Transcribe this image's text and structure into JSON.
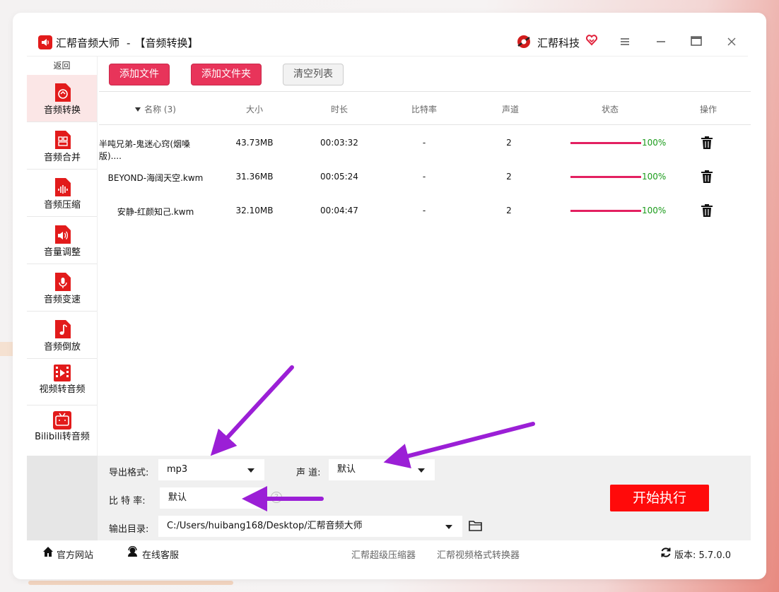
{
  "app": {
    "title": "汇帮音频大师",
    "separator": "-",
    "current_module": "【音频转换】",
    "brand": "汇帮科技"
  },
  "window_controls": {
    "menu_icon": "menu-icon",
    "minimize_icon": "minimize-icon",
    "maximize_icon": "maximize-icon",
    "close_icon": "close-icon"
  },
  "sidebar": {
    "back_label": "返回",
    "items": [
      {
        "label": "音频转换",
        "icon": "audio-convert-icon",
        "active": true
      },
      {
        "label": "音频合并",
        "icon": "audio-merge-icon",
        "active": false
      },
      {
        "label": "音频压缩",
        "icon": "audio-compress-icon",
        "active": false
      },
      {
        "label": "音量调整",
        "icon": "volume-adjust-icon",
        "active": false
      },
      {
        "label": "音频变速",
        "icon": "audio-speed-icon",
        "active": false
      },
      {
        "label": "音频倒放",
        "icon": "audio-reverse-icon",
        "active": false
      },
      {
        "label": "视频转音频",
        "icon": "video-to-audio-icon",
        "active": false
      },
      {
        "label": "Bilibili转音频",
        "icon": "bilibili-icon",
        "active": false
      }
    ]
  },
  "toolbar": {
    "add_file": "添加文件",
    "add_folder": "添加文件夹",
    "clear_list": "清空列表"
  },
  "table": {
    "headers": {
      "name": "名称 (3)",
      "size": "大小",
      "duration": "时长",
      "bitrate": "比特率",
      "channel": "声道",
      "status": "状态",
      "action": "操作"
    },
    "rows": [
      {
        "name": "半吨兄弟-鬼迷心窍(烟嗓版)....",
        "size": "43.73MB",
        "duration": "00:03:32",
        "bitrate": "-",
        "channel": "2",
        "progress": "100%"
      },
      {
        "name": "BEYOND-海阔天空.kwm",
        "size": "31.36MB",
        "duration": "00:05:24",
        "bitrate": "-",
        "channel": "2",
        "progress": "100%"
      },
      {
        "name": "安静-红颜知己.kwm",
        "size": "32.10MB",
        "duration": "00:04:47",
        "bitrate": "-",
        "channel": "2",
        "progress": "100%"
      }
    ]
  },
  "settings": {
    "format_label": "导出格式:",
    "format_value": "mp3",
    "channel_label": "声 道:",
    "channel_value": "默认",
    "bitrate_label": "比 特 率:",
    "bitrate_value": "默认",
    "output_label": "输出目录:",
    "output_value": "C:/Users/huibang168/Desktop/汇帮音频大师",
    "start_button": "开始执行"
  },
  "footer": {
    "website": "官方网站",
    "support": "在线客服",
    "link1": "汇帮超级压缩器",
    "link2": "汇帮视频格式转换器",
    "version_label": "版本:",
    "version": "5.7.0.0"
  },
  "colors": {
    "accent_red": "#e8345a",
    "start_red": "#ff0a0a",
    "progress": "#e32061",
    "progress_text": "#1a9b1a",
    "annotation_arrow": "#9b1fd6"
  }
}
